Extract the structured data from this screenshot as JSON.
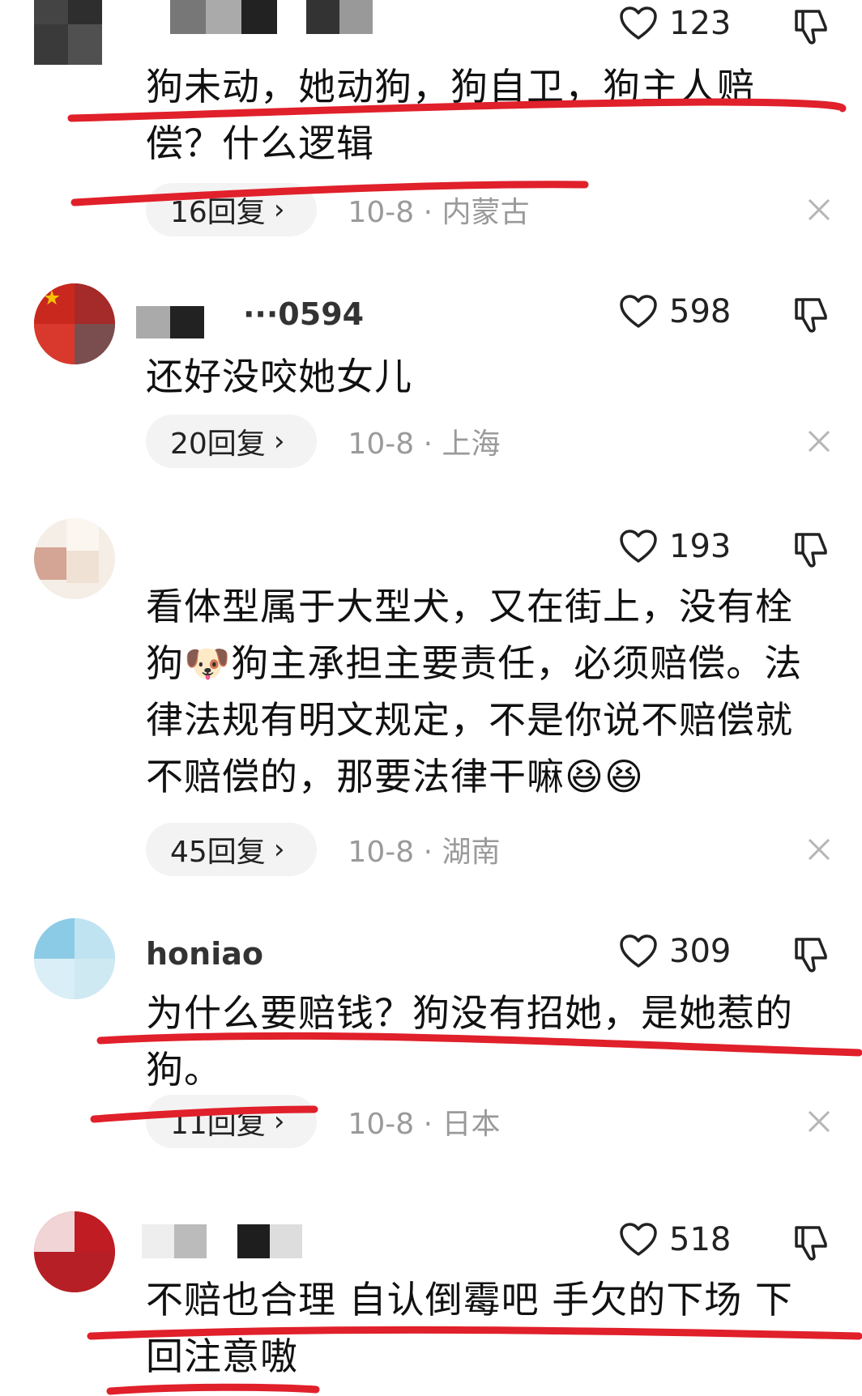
{
  "comments": [
    {
      "username": "",
      "likes": "123",
      "text": "狗未动，她动狗，狗自卫，狗主人赔偿？什么逻辑",
      "reply_count": "16回复",
      "date_location": "10-8 · 内蒙古"
    },
    {
      "username": "···0594",
      "likes": "598",
      "text": "还好没咬她女儿",
      "reply_count": "20回复",
      "date_location": "10-8 · 上海"
    },
    {
      "username": "",
      "likes": "193",
      "text": "看体型属于大型犬，又在街上，没有栓狗🐶狗主承担主要责任，必须赔偿。法律法规有明文规定，不是你说不赔偿就不赔偿的，那要法律干嘛😆😆",
      "reply_count": "45回复",
      "date_location": "10-8 · 湖南"
    },
    {
      "username": "honiao",
      "likes": "309",
      "text": "为什么要赔钱？狗没有招她，是她惹的狗。",
      "reply_count": "11回复",
      "date_location": "10-8 · 日本"
    },
    {
      "username": "",
      "likes": "518",
      "text": "不赔也合理 自认倒霉吧 手欠的下场 下回注意嗷",
      "reply_count": "",
      "date_location": ""
    }
  ],
  "icons": {
    "like": "heart-outline-icon",
    "dislike": "thumbs-down-outline-icon",
    "close": "close-icon",
    "reply_chevron": "chevron-right-icon"
  },
  "colors": {
    "annotation_line": "#e0202a",
    "meta_text": "#9a9a9a",
    "reply_pill_bg": "#f3f3f3"
  }
}
